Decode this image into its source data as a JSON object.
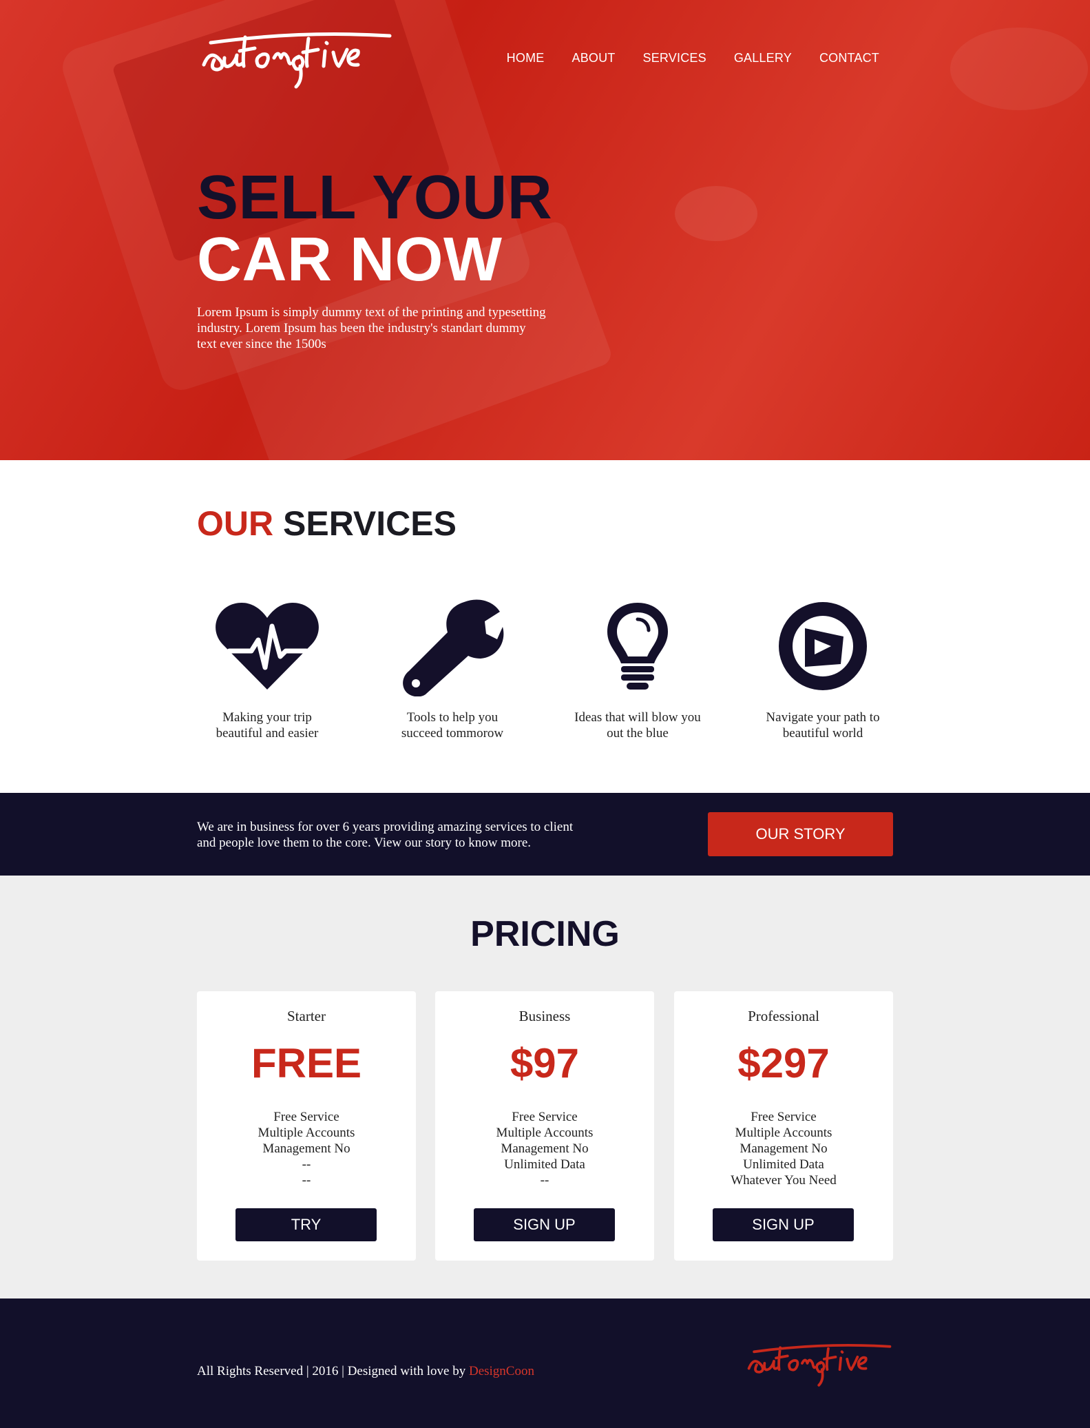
{
  "brand": {
    "logo_text": "automotive"
  },
  "nav": {
    "items": [
      "HOME",
      "ABOUT",
      "SERVICES",
      "GALLERY",
      "CONTACT"
    ]
  },
  "hero": {
    "title_line1": "SELL YOUR",
    "title_line2": "CAR NOW",
    "text": "Lorem Ipsum is simply dummy text of the printing and typesetting industry. Lorem Ipsum has been the industry's standart dummy text ever since the 1500s"
  },
  "services": {
    "title_accent": "OUR",
    "title_rest": "SERVICES",
    "items": [
      {
        "icon": "heartbeat-icon",
        "caption_l1": "Making your trip",
        "caption_l2": "beautiful and easier"
      },
      {
        "icon": "wrench-icon",
        "caption_l1": "Tools to help you",
        "caption_l2": "succeed tommorow"
      },
      {
        "icon": "lightbulb-icon",
        "caption_l1": "Ideas that will blow you",
        "caption_l2": "out the blue"
      },
      {
        "icon": "compass-icon",
        "caption_l1": "Navigate your path to",
        "caption_l2": "beautiful world"
      }
    ]
  },
  "story": {
    "text_l1": "We are in business for over 6 years providing amazing services to client",
    "text_l2": "and people love them to the core. View our story to know more.",
    "button_label": "OUR STORY"
  },
  "pricing": {
    "title": "PRICING",
    "plans": [
      {
        "name": "Starter",
        "price": "FREE",
        "features": [
          "Free Service",
          "Multiple Accounts",
          "Management No",
          "--",
          "--"
        ],
        "button": "TRY"
      },
      {
        "name": "Business",
        "price": "$97",
        "features": [
          "Free Service",
          "Multiple Accounts",
          "Management No",
          "Unlimited Data",
          "--"
        ],
        "button": "SIGN UP"
      },
      {
        "name": "Professional",
        "price": "$297",
        "features": [
          "Free Service",
          "Multiple Accounts",
          "Management No",
          "Unlimited Data",
          "Whatever You Need"
        ],
        "button": "SIGN UP"
      }
    ]
  },
  "footer": {
    "copyright": "All Rights Reserved | 2016 | Designed with love by ",
    "designer_link": "DesignCoon"
  },
  "colors": {
    "accent": "#c8281b",
    "dark": "#12102a",
    "light_bg": "#eeeeee"
  }
}
